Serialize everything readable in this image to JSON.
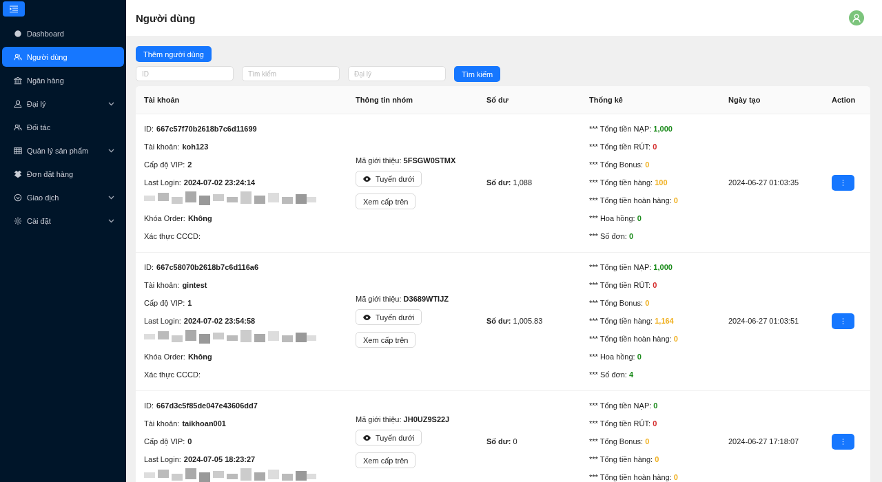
{
  "sidebar": {
    "items": [
      {
        "label": "Dashboard",
        "selected": false,
        "expandable": false
      },
      {
        "label": "Người dùng",
        "selected": true,
        "expandable": false
      },
      {
        "label": "Ngân hàng",
        "selected": false,
        "expandable": false
      },
      {
        "label": "Đại lý",
        "selected": false,
        "expandable": true
      },
      {
        "label": "Đối tác",
        "selected": false,
        "expandable": false
      },
      {
        "label": "Quản lý sản phẩm",
        "selected": false,
        "expandable": true
      },
      {
        "label": "Đơn đặt hàng",
        "selected": false,
        "expandable": false
      },
      {
        "label": "Giao dịch",
        "selected": false,
        "expandable": true
      },
      {
        "label": "Cài đặt",
        "selected": false,
        "expandable": true
      }
    ]
  },
  "header": {
    "title": "Người dùng"
  },
  "toolbar": {
    "add_button": "Thêm người dùng",
    "filters": [
      {
        "placeholder": "ID"
      },
      {
        "placeholder": "Tìm kiếm"
      },
      {
        "placeholder": "Đại lý"
      }
    ],
    "search_button": "Tìm kiếm"
  },
  "table": {
    "columns": [
      "Tài khoản",
      "Thông tin nhóm",
      "Số dư",
      "Thống kê",
      "Ngày tạo",
      "Action"
    ],
    "rows": [
      {
        "account": [
          {
            "kind": "field",
            "label": "ID:",
            "value": "667c57f70b2618b7c6d11699"
          },
          {
            "kind": "field",
            "label": "Tài khoản:",
            "value": "koh123"
          },
          {
            "kind": "field",
            "label": "Cấp độ VIP:",
            "value": "2"
          },
          {
            "kind": "field",
            "label": "Last Login:",
            "value": "2024-07-02 23:24:14"
          },
          {
            "kind": "redacted"
          },
          {
            "kind": "field",
            "label": "Khóa Order:",
            "value": "Không"
          },
          {
            "kind": "field",
            "label": "Xác thực CCCD:"
          }
        ],
        "group": {
          "label": "Mã giới thiệu:",
          "code": "5FSGW0STMX",
          "buttons": [
            "Tuyến dưới",
            "Xem cấp trên"
          ]
        },
        "balance": {
          "label": "Số dư:",
          "value": "1,088"
        },
        "stats": [
          {
            "label": "*** Tổng tiền NẠP:",
            "value": "1,000",
            "color": "#1a8a1a"
          },
          {
            "label": "*** Tổng tiền RÚT:",
            "value": "0",
            "color": "#d42a2a"
          },
          {
            "label": "*** Tổng Bonus:",
            "value": "0",
            "color": "#f0b020"
          },
          {
            "label": "*** Tổng tiền hàng:",
            "value": "100",
            "color": "#f0b020"
          },
          {
            "label": "*** Tổng tiền hoàn hàng:",
            "value": "0",
            "color": "#f0b020"
          },
          {
            "label": "*** Hoa hồng:",
            "value": "0",
            "color": "#1a8a1a"
          },
          {
            "label": "*** Số đơn:",
            "value": "0",
            "color": "#1a8a1a"
          }
        ],
        "created": "2024-06-27 01:03:35"
      },
      {
        "account": [
          {
            "kind": "field",
            "label": "ID:",
            "value": "667c58070b2618b7c6d116a6"
          },
          {
            "kind": "field",
            "label": "Tài khoản:",
            "value": "gintest"
          },
          {
            "kind": "field",
            "label": "Cấp độ VIP:",
            "value": "1"
          },
          {
            "kind": "field",
            "label": "Last Login:",
            "value": "2024-07-02 23:54:58"
          },
          {
            "kind": "redacted"
          },
          {
            "kind": "field",
            "label": "Khóa Order:",
            "value": "Không"
          },
          {
            "kind": "field",
            "label": "Xác thực CCCD:"
          }
        ],
        "group": {
          "label": "Mã giới thiệu:",
          "code": "D3689WTIJZ",
          "buttons": [
            "Tuyến dưới",
            "Xem cấp trên"
          ]
        },
        "balance": {
          "label": "Số dư:",
          "value": "1,005.83"
        },
        "stats": [
          {
            "label": "*** Tổng tiền NẠP:",
            "value": "1,000",
            "color": "#1a8a1a"
          },
          {
            "label": "*** Tổng tiền RÚT:",
            "value": "0",
            "color": "#d42a2a"
          },
          {
            "label": "*** Tổng Bonus:",
            "value": "0",
            "color": "#f0b020"
          },
          {
            "label": "*** Tổng tiền hàng:",
            "value": "1,164",
            "color": "#f0b020"
          },
          {
            "label": "*** Tổng tiền hoàn hàng:",
            "value": "0",
            "color": "#f0b020"
          },
          {
            "label": "*** Hoa hồng:",
            "value": "0",
            "color": "#1a8a1a"
          },
          {
            "label": "*** Số đơn:",
            "value": "4",
            "color": "#1a8a1a"
          }
        ],
        "created": "2024-06-27 01:03:51"
      },
      {
        "account": [
          {
            "kind": "field",
            "label": "ID:",
            "value": "667d3c5f85de047e43606dd7"
          },
          {
            "kind": "field",
            "label": "Tài khoản:",
            "value": "taikhoan001"
          },
          {
            "kind": "field",
            "label": "Cấp độ VIP:",
            "value": "0"
          },
          {
            "kind": "field",
            "label": "Last Login:",
            "value": "2024-07-05 18:23:27"
          },
          {
            "kind": "redacted"
          }
        ],
        "group": {
          "label": "Mã giới thiệu:",
          "code": "JH0UZ9S22J",
          "buttons": [
            "Tuyến dưới",
            "Xem cấp trên"
          ]
        },
        "balance": {
          "label": "Số dư:",
          "value": "0"
        },
        "stats": [
          {
            "label": "*** Tổng tiền NẠP:",
            "value": "0",
            "color": "#1a8a1a"
          },
          {
            "label": "*** Tổng tiền RÚT:",
            "value": "0",
            "color": "#d42a2a"
          },
          {
            "label": "*** Tổng Bonus:",
            "value": "0",
            "color": "#f0b020"
          },
          {
            "label": "*** Tổng tiền hàng:",
            "value": "0",
            "color": "#f0b020"
          },
          {
            "label": "*** Tổng tiền hoàn hàng:",
            "value": "0",
            "color": "#f0b020"
          }
        ],
        "created": "2024-06-27 17:18:07"
      }
    ]
  }
}
